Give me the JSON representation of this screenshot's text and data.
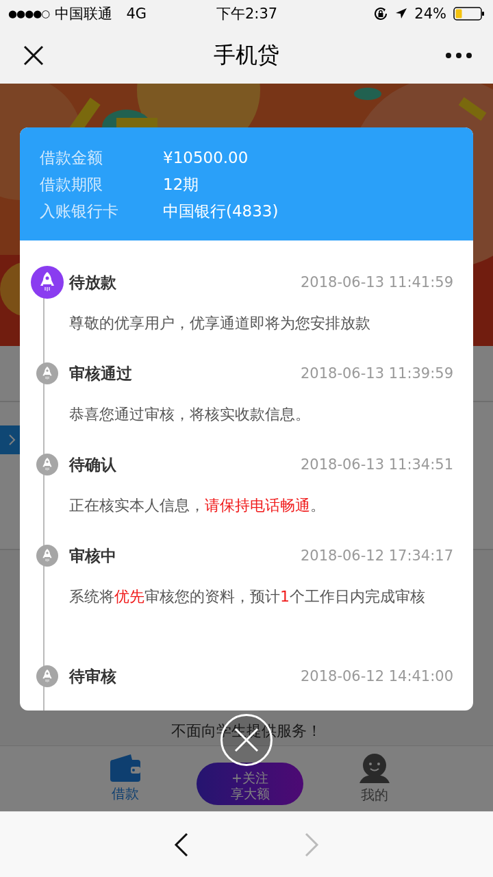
{
  "status_bar": {
    "signal": "●●●●○",
    "carrier": "中国联通",
    "network": "4G",
    "time": "下午2:37",
    "battery": "24%"
  },
  "header": {
    "title": "手机贷"
  },
  "page": {
    "notice": "不面向学生提供服务！",
    "tabs": [
      {
        "kind": "wallet",
        "label": "借款",
        "selected": true
      },
      {
        "kind": "promo",
        "lines": [
          "+关注",
          "享大额"
        ]
      },
      {
        "kind": "profile",
        "label": "我的",
        "selected": false
      }
    ]
  },
  "modal": {
    "details": [
      {
        "label": "借款金额",
        "value": "¥10500.00"
      },
      {
        "label": "借款期限",
        "value": "12期"
      },
      {
        "label": "入账银行卡",
        "value": "中国银行(4833)"
      }
    ],
    "timeline": [
      {
        "title": "待放款",
        "time": "2018-06-13 11:41:59",
        "active": true,
        "description": [
          {
            "text": "尊敬的优享用户，优享通道即将为您安排放款",
            "highlight": false
          }
        ]
      },
      {
        "title": "审核通过",
        "time": "2018-06-13 11:39:59",
        "active": false,
        "description": [
          {
            "text": "恭喜您通过审核，将核实收款信息。",
            "highlight": false
          }
        ]
      },
      {
        "title": "待确认",
        "time": "2018-06-13 11:34:51",
        "active": false,
        "description": [
          {
            "text": "正在核实本人信息，",
            "highlight": false
          },
          {
            "text": "请保持电话畅通",
            "highlight": true
          },
          {
            "text": "。",
            "highlight": false
          }
        ]
      },
      {
        "title": "审核中",
        "time": "2018-06-12 17:34:17",
        "active": false,
        "description": [
          {
            "text": "系统将",
            "highlight": false
          },
          {
            "text": "优先",
            "highlight": true
          },
          {
            "text": "审核您的资料，预计",
            "highlight": false
          },
          {
            "text": "1",
            "highlight": true
          },
          {
            "text": "个工作日内完成审核",
            "highlight": false
          }
        ]
      },
      {
        "title": "待审核",
        "time": "2018-06-12 14:41:00",
        "active": false
      }
    ]
  },
  "browser_toolbar": {
    "back_disabled": false,
    "forward_disabled": true
  }
}
